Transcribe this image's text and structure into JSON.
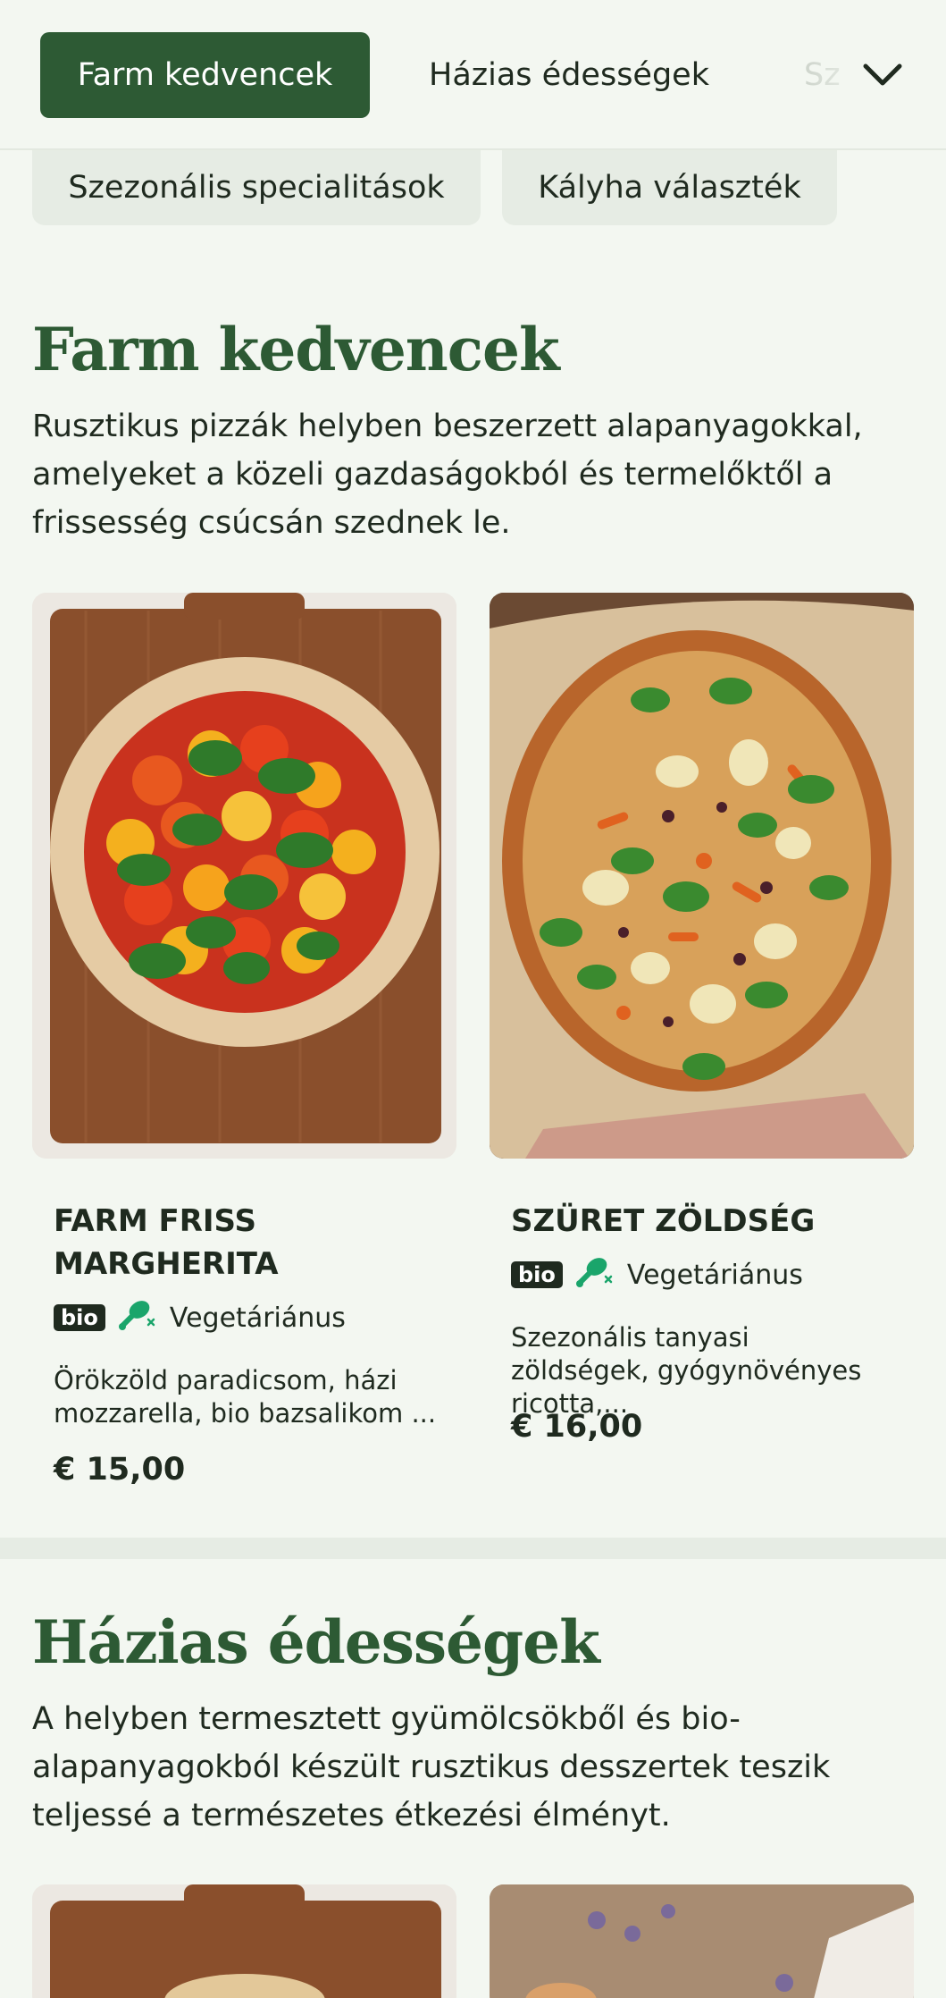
{
  "nav": {
    "tabs": [
      "Farm kedvencek",
      "Házias édességek",
      "Sz"
    ],
    "chips": [
      "Szezonális specialitások",
      "Kályha választék"
    ]
  },
  "sections": [
    {
      "title": "Farm kedvencek",
      "description": "Rusztikus pizzák helyben beszerzett alapanyagokkal, amelyeket a közeli gazdaságokból és termelőktől a frissesség csúcsán szednek le.",
      "items": [
        {
          "title": "FARM FRISS MARGHERITA",
          "bio": "bio",
          "diet": "Vegetáriánus",
          "description": "Örökzöld paradicsom, házi mozzarella, bio bazsalikom ...",
          "price": "€ 15,00"
        },
        {
          "title": "SZÜRET ZÖLDSÉG",
          "bio": "bio",
          "diet": "Vegetáriánus",
          "description": "Szezonális tanyasi zöldségek, gyógynövényes ricotta,...",
          "price": "€ 16,00"
        }
      ]
    },
    {
      "title": "Házias édességek",
      "description": "A helyben termesztett gyümölcsökből és bio-alapanyagokból készült rusztikus desszertek teszik teljessé a természetes étkezési élményt."
    }
  ],
  "colors": {
    "brand": "#2d5a34",
    "leaf": "#1aa56b",
    "background": "#f3f7f1"
  }
}
